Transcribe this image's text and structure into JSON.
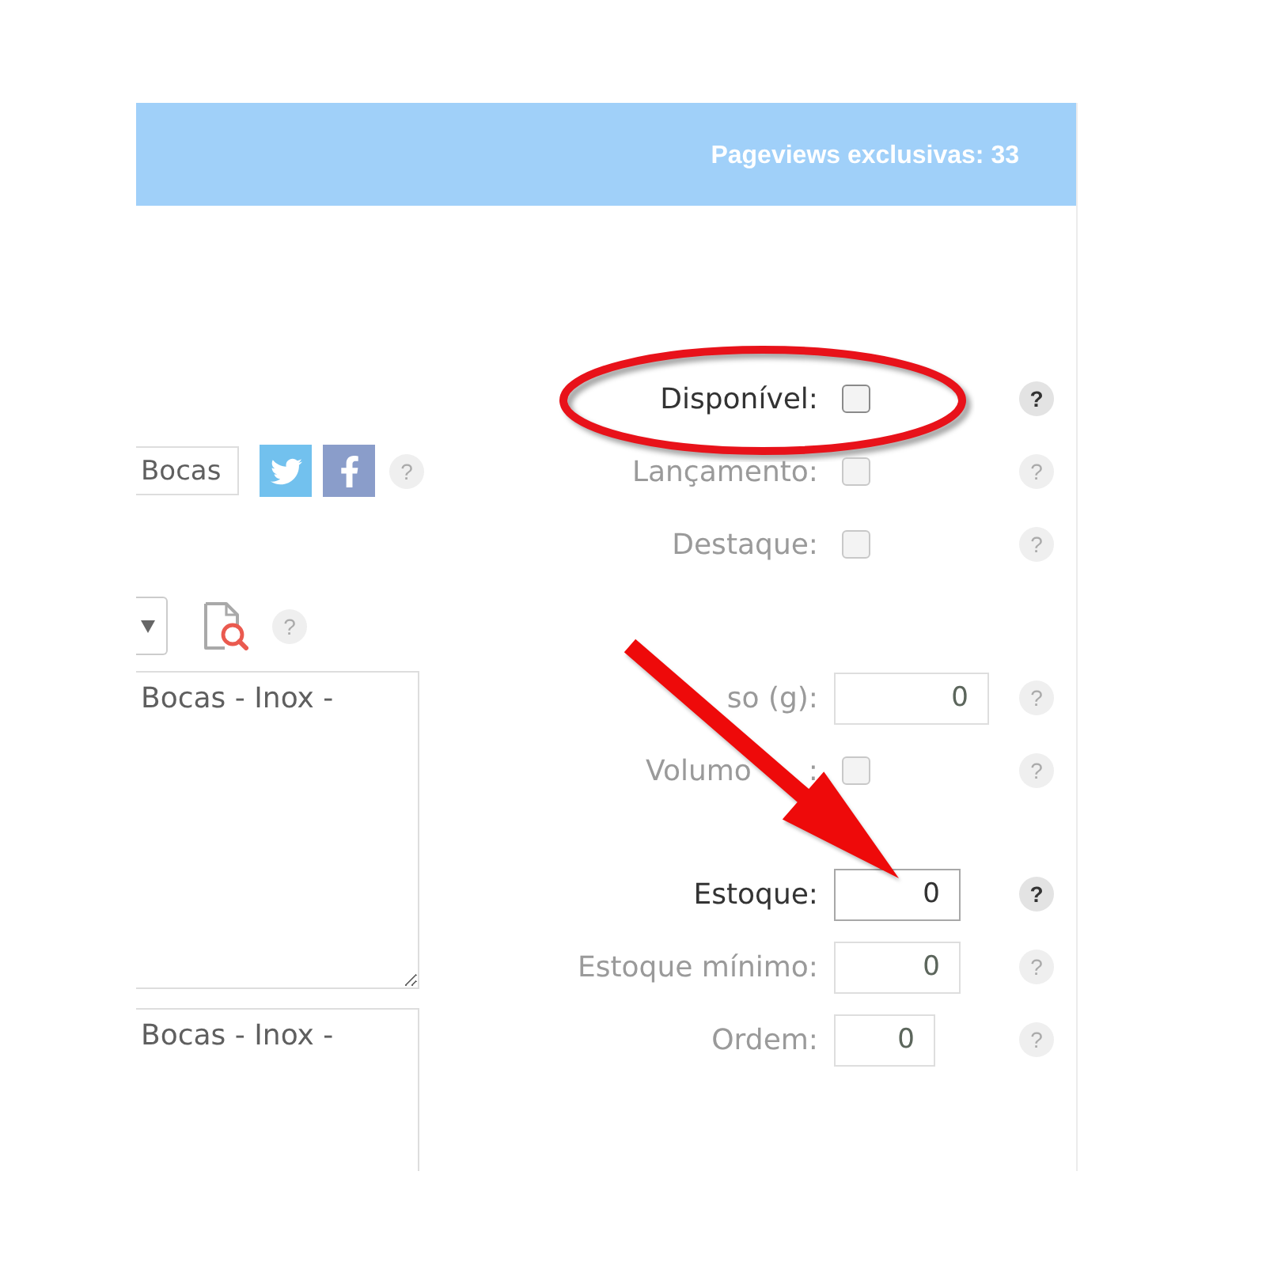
{
  "header": {
    "text": "Pageviews exclusivas: 33"
  },
  "left": {
    "text_field": {
      "value": "Bocas",
      "help": "?"
    },
    "tools_row": {
      "help": "?"
    },
    "text_areas": [
      {
        "value": "Bocas - Inox -"
      },
      {
        "value": "Bocas - Inox -"
      }
    ]
  },
  "sections": [
    {
      "fields": [
        {
          "kind": "checkbox",
          "label": "Disponível:",
          "checked": false,
          "highlighted": true,
          "circled": true,
          "help": "?"
        },
        {
          "kind": "checkbox",
          "label": "Lançamento:",
          "checked": false,
          "highlighted": false,
          "help": "?"
        },
        {
          "kind": "checkbox",
          "label": "Destaque:",
          "checked": false,
          "highlighted": false,
          "help": "?"
        }
      ]
    },
    {
      "fields": [
        {
          "kind": "number",
          "label": "so (g):",
          "value": "0",
          "highlighted": false,
          "help": "?"
        },
        {
          "kind": "checkbox",
          "label": "Volumo",
          "label_tail": ":",
          "checked": false,
          "highlighted": false,
          "help": "?"
        }
      ]
    },
    {
      "fields": [
        {
          "kind": "number",
          "label": "Estoque:",
          "value": "0",
          "highlighted": true,
          "arrow": true,
          "help": "?"
        },
        {
          "kind": "number",
          "label": "Estoque mínimo:",
          "value": "0",
          "highlighted": false,
          "help": "?"
        },
        {
          "kind": "number",
          "label": "Ordem:",
          "value": "0",
          "highlighted": false,
          "help": "?"
        }
      ]
    }
  ]
}
